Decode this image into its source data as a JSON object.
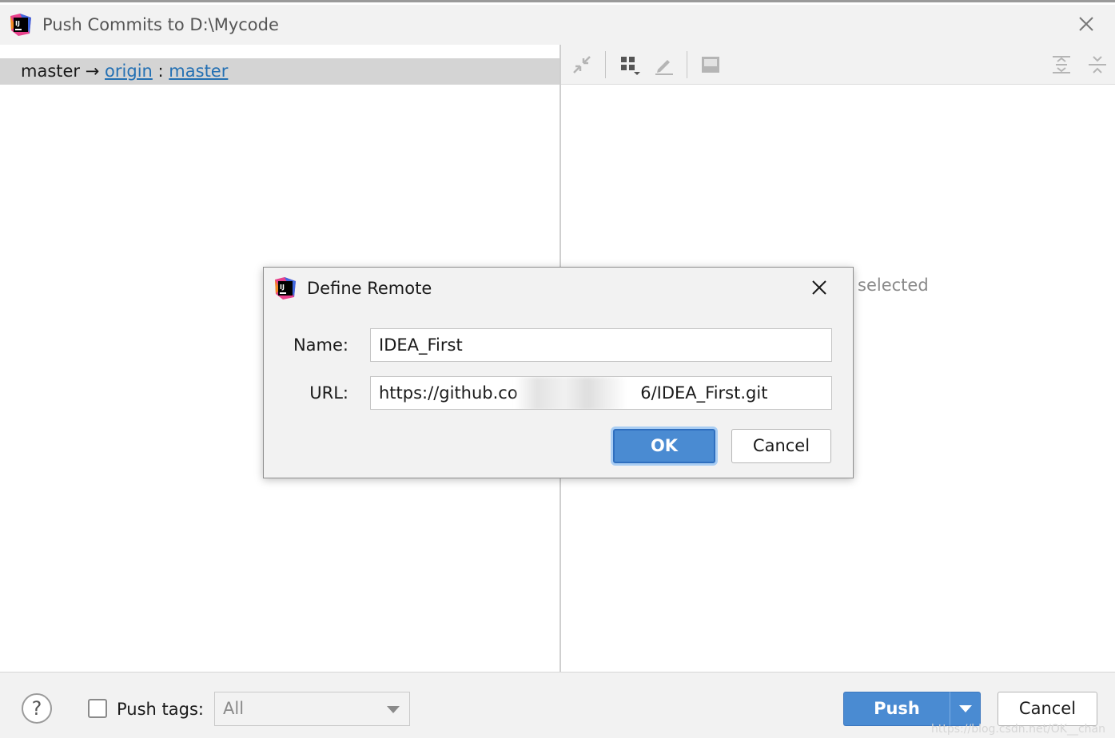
{
  "window": {
    "title": "Push Commits to D:\\Mycode"
  },
  "branch": {
    "local": "master",
    "arrow": "→",
    "remote": "origin",
    "separator": ":",
    "target": "master"
  },
  "right_pane": {
    "empty_text": "selected"
  },
  "toolbar": {
    "icons": [
      "collapse-icon",
      "group-by-icon",
      "edit-icon",
      "preview-icon",
      "expand-all-icon",
      "collapse-all-icon"
    ]
  },
  "bottom": {
    "help_label": "?",
    "push_tags_label": "Push tags:",
    "push_tags_checked": false,
    "tags_select_value": "All",
    "push_label": "Push",
    "cancel_label": "Cancel",
    "watermark": "https://blog.csdn.net/OK__chan"
  },
  "dialog": {
    "title": "Define Remote",
    "name_label": "Name:",
    "name_value": "IDEA_First",
    "url_label": "URL:",
    "url_value": "https://github.co                       6/IDEA_First.git",
    "ok_label": "OK",
    "cancel_label": "Cancel"
  },
  "colors": {
    "accent": "#4a8bd2",
    "link": "#2470b3",
    "background": "#f2f2f2",
    "selection": "#d4d4d4"
  }
}
